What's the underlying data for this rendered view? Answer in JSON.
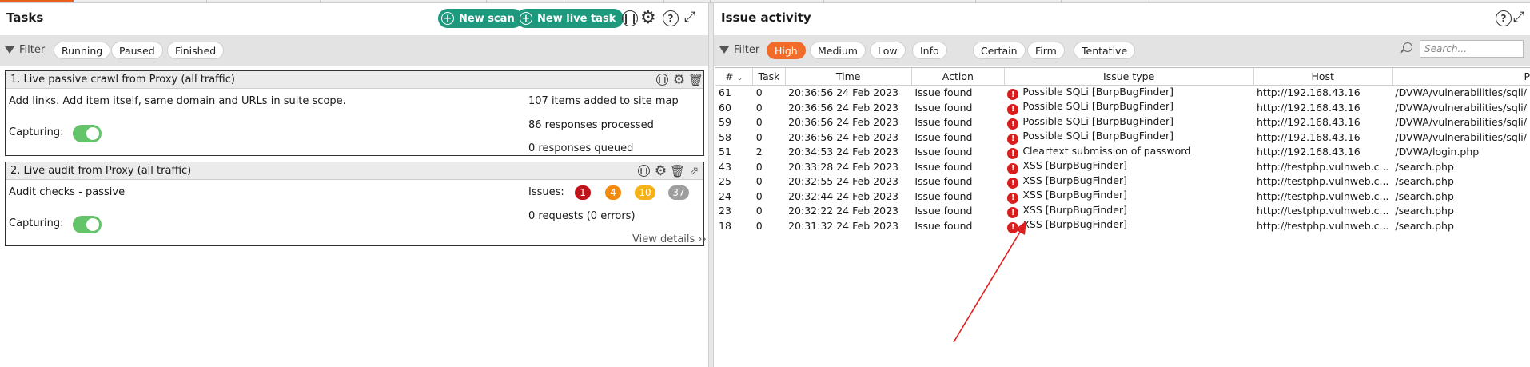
{
  "tasks": {
    "title": "Tasks",
    "new_scan_label": "New scan",
    "new_live_task_label": "New live task",
    "filter_label": "Filter",
    "filter_chips": [
      "Running",
      "Paused",
      "Finished"
    ],
    "task1": {
      "title": "1. Live passive crawl from Proxy (all traffic)",
      "description": "Add links. Add item itself, same domain and URLs in suite scope.",
      "capturing_label": "Capturing:",
      "stat1": "107 items added to site map",
      "stat2": "86 responses processed",
      "stat3": "0 responses queued"
    },
    "task2": {
      "title": "2. Live audit from Proxy (all traffic)",
      "description": "Audit checks - passive",
      "capturing_label": "Capturing:",
      "issues_label": "Issues:",
      "badges": [
        "1",
        "4",
        "10",
        "37"
      ],
      "requests": "0 requests (0 errors)",
      "view_details": "View details ››"
    }
  },
  "issues": {
    "title": "Issue activity",
    "filter_label": "Filter",
    "severity_chips": [
      "High",
      "Medium",
      "Low",
      "Info"
    ],
    "confidence_chips": [
      "Certain",
      "Firm",
      "Tentative"
    ],
    "search_placeholder": "Search...",
    "columns": [
      "#",
      "Task",
      "Time",
      "Action",
      "Issue type",
      "Host",
      "P"
    ],
    "rows": [
      {
        "num": "61",
        "task": "0",
        "time": "20:36:56 24 Feb 2023",
        "action": "Issue found",
        "type": "Possible SQLi [BurpBugFinder]",
        "host": "http://192.168.43.16",
        "path": "/DVWA/vulnerabilities/sqli/"
      },
      {
        "num": "60",
        "task": "0",
        "time": "20:36:56 24 Feb 2023",
        "action": "Issue found",
        "type": "Possible SQLi [BurpBugFinder]",
        "host": "http://192.168.43.16",
        "path": "/DVWA/vulnerabilities/sqli/"
      },
      {
        "num": "59",
        "task": "0",
        "time": "20:36:56 24 Feb 2023",
        "action": "Issue found",
        "type": "Possible SQLi [BurpBugFinder]",
        "host": "http://192.168.43.16",
        "path": "/DVWA/vulnerabilities/sqli/"
      },
      {
        "num": "58",
        "task": "0",
        "time": "20:36:56 24 Feb 2023",
        "action": "Issue found",
        "type": "Possible SQLi [BurpBugFinder]",
        "host": "http://192.168.43.16",
        "path": "/DVWA/vulnerabilities/sqli/"
      },
      {
        "num": "51",
        "task": "2",
        "time": "20:34:53 24 Feb 2023",
        "action": "Issue found",
        "type": "Cleartext submission of password",
        "host": "http://192.168.43.16",
        "path": "/DVWA/login.php"
      },
      {
        "num": "43",
        "task": "0",
        "time": "20:33:28 24 Feb 2023",
        "action": "Issue found",
        "type": "XSS [BurpBugFinder]",
        "host": "http://testphp.vulnweb.c...",
        "path": "/search.php"
      },
      {
        "num": "25",
        "task": "0",
        "time": "20:32:55 24 Feb 2023",
        "action": "Issue found",
        "type": "XSS [BurpBugFinder]",
        "host": "http://testphp.vulnweb.c...",
        "path": "/search.php"
      },
      {
        "num": "24",
        "task": "0",
        "time": "20:32:44 24 Feb 2023",
        "action": "Issue found",
        "type": "XSS [BurpBugFinder]",
        "host": "http://testphp.vulnweb.c...",
        "path": "/search.php"
      },
      {
        "num": "23",
        "task": "0",
        "time": "20:32:22 24 Feb 2023",
        "action": "Issue found",
        "type": "XSS [BurpBugFinder]",
        "host": "http://testphp.vulnweb.c...",
        "path": "/search.php"
      },
      {
        "num": "18",
        "task": "0",
        "time": "20:31:32 24 Feb 2023",
        "action": "Issue found",
        "type": "XSS [BurpBugFinder]",
        "host": "http://testphp.vulnweb.c...",
        "path": "/search.php"
      }
    ]
  },
  "colors": {
    "accent_orange": "#f26b29",
    "teal_button": "#1d9a7d",
    "high_severity": "#d91d1d",
    "badge_high": "#c0141b",
    "badge_medium": "#f28a0f",
    "badge_low": "#f5b117",
    "badge_info": "#9e9e9e",
    "annotation_arrow": "#e02020"
  }
}
